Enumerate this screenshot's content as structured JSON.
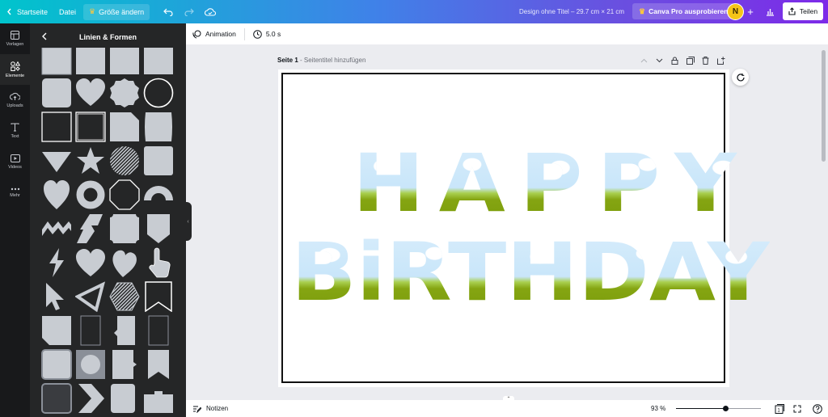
{
  "topbar": {
    "home_label": "Startseite",
    "file_label": "Datei",
    "resize_label": "Größe ändern",
    "doc_title": "Design ohne Titel – 29.7 cm × 21 cm",
    "pro_label": "Canva Pro ausprobieren",
    "avatar_initial": "N",
    "share_label": "Teilen"
  },
  "rail": {
    "items": [
      {
        "label": "Vorlagen",
        "icon": "templates-icon"
      },
      {
        "label": "Elemente",
        "icon": "elements-icon"
      },
      {
        "label": "Uploads",
        "icon": "upload-icon"
      },
      {
        "label": "Text",
        "icon": "text-icon"
      },
      {
        "label": "Videos",
        "icon": "video-icon"
      },
      {
        "label": "Mehr",
        "icon": "more-icon"
      }
    ],
    "active": "Elemente"
  },
  "panel": {
    "title": "Linien & Formen"
  },
  "toolbar": {
    "animation_label": "Animation",
    "duration_label": "5.0 s"
  },
  "page": {
    "label": "Seite 1",
    "title_placeholder": " - Seitentitel hinzufügen",
    "line1": "HAPPY",
    "line2": "BiRTHDAY"
  },
  "bottombar": {
    "notes_label": "Notizen",
    "zoom_label": "93 %",
    "zoom_level": 0.59,
    "page_count": "1"
  },
  "colors": {
    "accent_gradient_start": "#00c4cc",
    "accent_gradient_end": "#7d2ae8",
    "shape_fill": "#c8ccd2",
    "text_sky": "#cde7fa",
    "text_grass": "#7a9b0a"
  }
}
